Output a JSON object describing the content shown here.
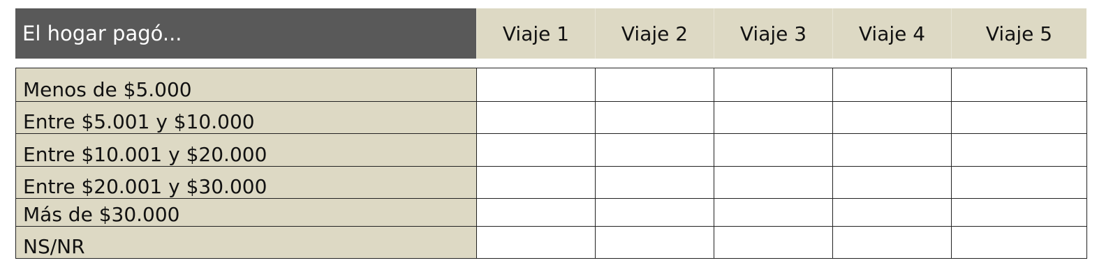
{
  "header": {
    "label": "El hogar pagó...",
    "trips": [
      "Viaje 1",
      "Viaje 2",
      "Viaje 3",
      "Viaje 4",
      "Viaje 5"
    ]
  },
  "rows": [
    {
      "label": "Menos de $5.000"
    },
    {
      "label": "Entre $5.001 y $10.000"
    },
    {
      "label": "Entre $10.001 y $20.000"
    },
    {
      "label": "Entre $20.001 y $30.000"
    },
    {
      "label": "Más de $30.000"
    },
    {
      "label": "NS/NR"
    }
  ],
  "colors": {
    "header_dark": "#595959",
    "header_light": "#ddd9c4",
    "row_label_bg": "#ddd9c4",
    "border": "#222222"
  }
}
